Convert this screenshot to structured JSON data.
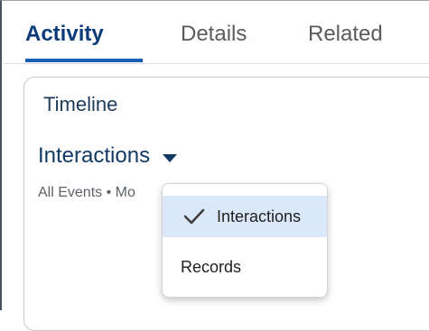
{
  "tabs": {
    "items": [
      {
        "label": "Activity",
        "active": true
      },
      {
        "label": "Details",
        "active": false
      },
      {
        "label": "Related",
        "active": false
      }
    ]
  },
  "timeline": {
    "title": "Timeline",
    "filter": {
      "selected_label": "Interactions",
      "icon": "chevron-down-icon"
    },
    "subtext": "All Events • Mo"
  },
  "menu": {
    "items": [
      {
        "label": "Interactions",
        "selected": true,
        "icon": "check-icon"
      },
      {
        "label": "Records",
        "selected": false
      }
    ]
  },
  "colors": {
    "accent": "#1b5fb8",
    "active_tab_text": "#0a3a78",
    "selected_menu_bg": "#dbe8fa",
    "text_primary": "#123a64"
  }
}
